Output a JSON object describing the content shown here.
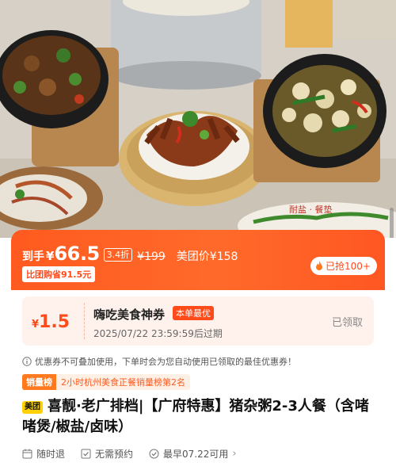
{
  "hero": {
    "photo_caption_visible": "",
    "bowl_text": "耐盐 · 餐垫"
  },
  "price_banner": {
    "daoshou_label": "到手",
    "currency": "¥",
    "price": "66.5",
    "discount": "3.4折",
    "original_price": "¥199",
    "meituan_price": "美团价¥158",
    "group_saving": "比团购省91.5元",
    "hot_sold": "已抢100+"
  },
  "coupon": {
    "currency": "¥",
    "amount": "1.5",
    "title": "嗨吃美食神券",
    "badge": "本单最优",
    "expire": "2025/07/22 23:59:59后过期",
    "status": "已领取"
  },
  "notice": "优惠券不可叠加使用，下单时会为您自动使用已领取的最佳优惠券！",
  "rank": {
    "tag": "销量榜",
    "text": "2小时杭州美食正餐销量榜第2名"
  },
  "product": {
    "logo": "美团",
    "title": "喜靓·老广排档|【广府特惠】猪杂粥2-3人餐（含啫啫煲/椒盐/卤味）"
  },
  "features": [
    {
      "icon": "calendar-icon",
      "label": "随时退"
    },
    {
      "icon": "check-square-icon",
      "label": "无需预约"
    },
    {
      "icon": "check-circle-icon",
      "label": "最早07.22可用"
    }
  ],
  "colors": {
    "accent": "#ff5a1f",
    "coupon_bg": "#fff2ec",
    "logo_yellow": "#ffd100"
  }
}
